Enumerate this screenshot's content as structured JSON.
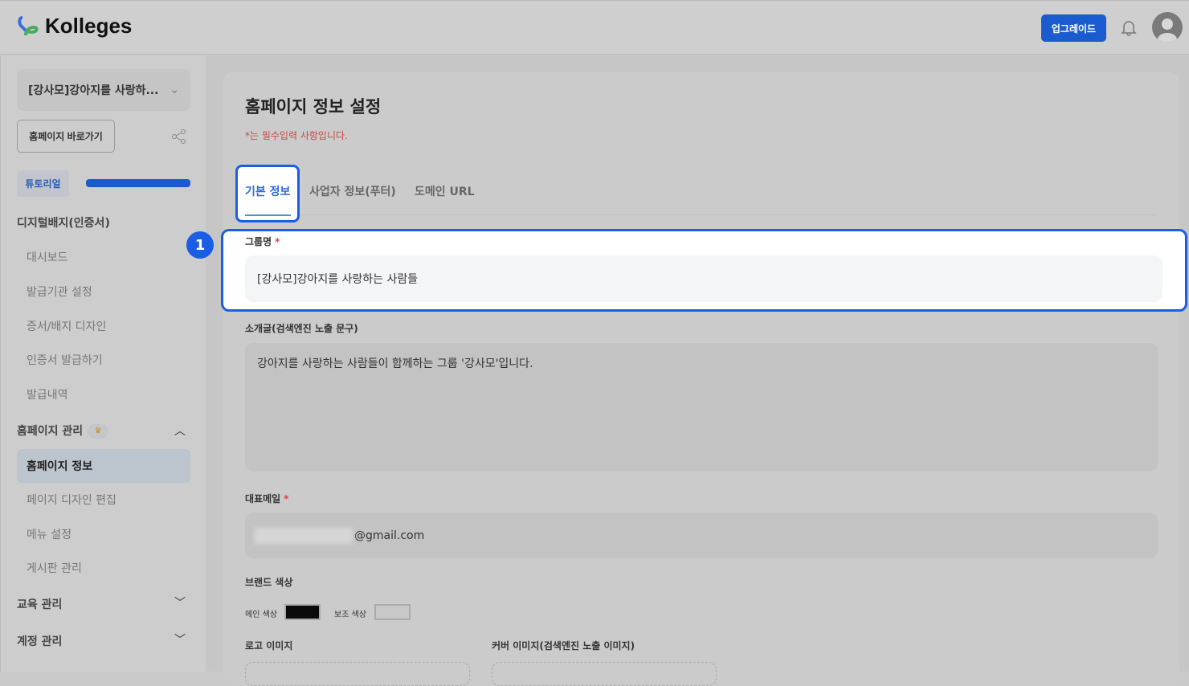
{
  "header": {
    "brand": "Kolleges",
    "upgrade": "업그레이드"
  },
  "sidebar": {
    "group_selector": "[강사모]강아지를 사랑하...",
    "home_link": "홈페이지 바로가기",
    "tutorial": "튜토리얼",
    "tutorial_progress": 1.0,
    "sections": [
      {
        "label": "디지털배지(인증서)",
        "items": [
          "대시보드",
          "발급기관 설정",
          "증서/배지 디자인",
          "인증서 발급하기",
          "발급내역"
        ]
      },
      {
        "label": "홈페이지 관리",
        "items": [
          "홈페이지 정보",
          "페이지 디자인 편집",
          "메뉴 설정",
          "게시판 관리"
        ],
        "active": "홈페이지 정보"
      },
      {
        "label": "교육 관리"
      },
      {
        "label": "계정 관리"
      }
    ]
  },
  "main": {
    "title": "홈페이지 정보 설정",
    "required_note": "*는 필수입력 사항입니다.",
    "tabs": [
      "기본 정보",
      "사업자 정보(푸터)",
      "도메인 URL"
    ],
    "step_badge": "1",
    "fields": {
      "group_name_label": "그룹명",
      "group_name_value": "[강사모]강아지를 사랑하는 사람들",
      "intro_label": "소개글(검색엔진 노출 문구)",
      "intro_value": "강아지를 사랑하는 사람들이 함께하는 그룹 '강사모'입니다.",
      "email_label": "대표메일",
      "email_value": "@gmail.com",
      "brand_color_label": "브랜드 색상",
      "main_color_label": "메인 색상",
      "sub_color_label": "보조 색상",
      "main_color": "#0a0a0a",
      "sub_color": "#c8c8c8",
      "logo_label": "로고 이미지",
      "cover_label": "커버 이미지(검색엔진 노출 이미지)",
      "required_mark": "*"
    }
  }
}
